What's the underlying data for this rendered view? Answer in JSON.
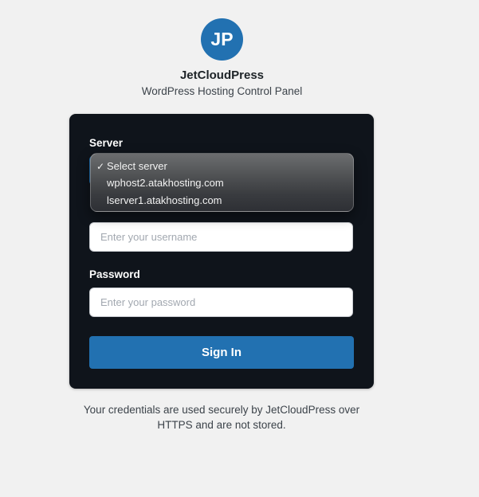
{
  "brand": {
    "initials": "JP",
    "name": "JetCloudPress",
    "tagline": "WordPress Hosting Control Panel",
    "accent_color": "#2271b1"
  },
  "form": {
    "server_label": "Server",
    "server_options": [
      {
        "label": "Select server",
        "checked": true
      },
      {
        "label": "wphost2.atakhosting.com",
        "checked": false
      },
      {
        "label": "lserver1.atakhosting.com",
        "checked": false
      }
    ],
    "check_icon": "checkmark-icon",
    "username_placeholder": "Enter your username",
    "username_value": "",
    "password_label": "Password",
    "password_placeholder": "Enter your password",
    "password_value": "",
    "signin_label": "Sign In"
  },
  "footer": {
    "note": "Your credentials are used securely by JetCloudPress over HTTPS and are not stored."
  }
}
